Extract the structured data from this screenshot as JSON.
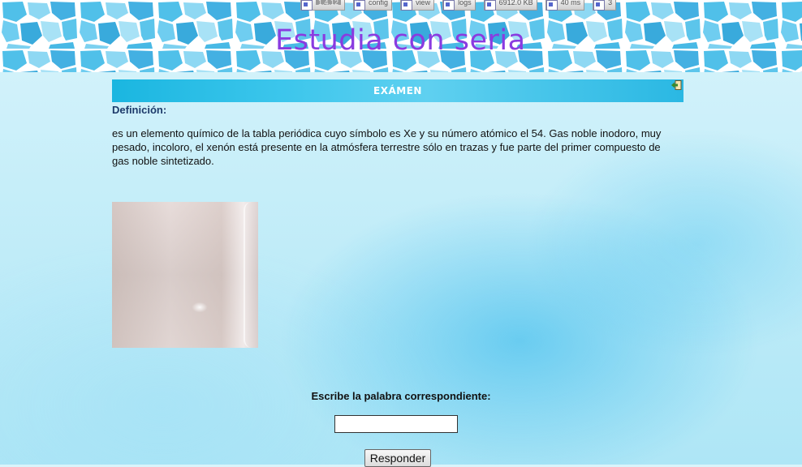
{
  "header": {
    "site_title": "Estudia con seria"
  },
  "toolbar": {
    "items": [
      {
        "label": "1.4.12",
        "icon": "debug-icon"
      },
      {
        "label": "config",
        "icon": "debug-icon"
      },
      {
        "label": "view",
        "icon": "debug-icon"
      },
      {
        "label": "logs",
        "icon": "debug-icon"
      },
      {
        "label": "6912.0 KB",
        "icon": "debug-icon"
      },
      {
        "label": "40 ms",
        "icon": "debug-icon"
      },
      {
        "label": "3",
        "icon": "debug-icon"
      }
    ]
  },
  "exam": {
    "title": "EXÁMEN",
    "exit_icon": "exit-icon"
  },
  "definition": {
    "label": "Definición:",
    "text": "es un elemento químico de la tabla periódica cuyo símbolo es Xe y su número atómico el 54. Gas noble inodoro, muy pesado, incoloro, el xenón está presente en la atmósfera terrestre sólo en trazas y fue parte del primer compuesto de gas noble sintetizado.",
    "image": "xenon-gas-tube-photo"
  },
  "answer": {
    "label": "Escribe la palabra correspondiente:",
    "input_value": "",
    "button_label": "Responder"
  }
}
